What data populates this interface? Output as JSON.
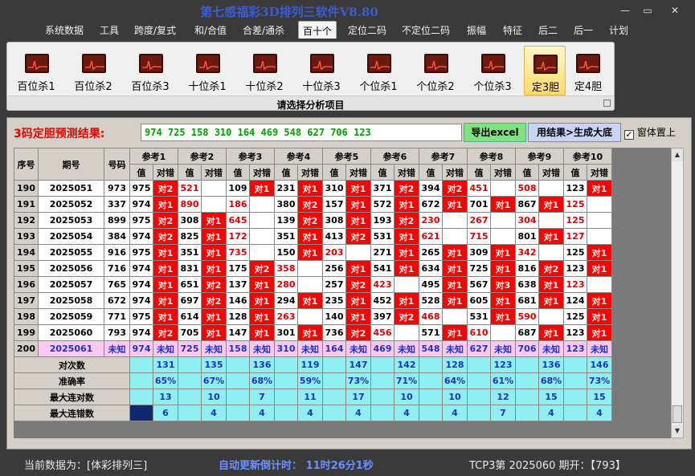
{
  "app": {
    "title": "第七感福彩3D排列三软件V8.80",
    "window_buttons": [
      "—",
      "▭",
      "✕"
    ]
  },
  "menu": {
    "items": [
      "系统数据",
      "工具",
      "跨度/复式",
      "和/合值",
      "合差/通杀",
      "百十个",
      "定位二码",
      "不定位二码",
      "振幅",
      "特征",
      "后二",
      "后一",
      "计划"
    ],
    "active_index": 5
  },
  "ribbon": {
    "buttons": [
      "百位杀1",
      "百位杀2",
      "百位杀3",
      "十位杀1",
      "十位杀2",
      "十位杀3",
      "个位杀1",
      "个位杀2",
      "个位杀3",
      "定3胆",
      "定4胆"
    ],
    "active_index": 9,
    "caption": "请选择分析项目"
  },
  "result": {
    "label": "3码定胆预测结果:",
    "value": "974  725  158  310  164  469  548  627  706  123",
    "excel_button": "导出excel",
    "generate_button": "用结果>生成大底",
    "checkbox_label": "窗体置上",
    "checkbox_checked": true,
    "checkbox_mark": "✓"
  },
  "table": {
    "head_seq": "序号",
    "head_period": "期号",
    "head_number": "号码",
    "refs": [
      "参考1",
      "参考2",
      "参考3",
      "参考4",
      "参考5",
      "参考6",
      "参考7",
      "参考8",
      "参考9",
      "参考10"
    ],
    "sub_value": "值",
    "sub_result": "对错",
    "rows": [
      {
        "seq": "190",
        "period": "2025051",
        "number": "973",
        "cells": [
          [
            "975",
            "对2"
          ],
          [
            "521",
            ""
          ],
          [
            "109",
            "对1"
          ],
          [
            "231",
            "对1"
          ],
          [
            "310",
            "对1"
          ],
          [
            "371",
            "对2"
          ],
          [
            "394",
            "对2"
          ],
          [
            "451",
            ""
          ],
          [
            "508",
            ""
          ],
          [
            "123",
            "对1"
          ]
        ]
      },
      {
        "seq": "191",
        "period": "2025052",
        "number": "337",
        "cells": [
          [
            "974",
            "对1"
          ],
          [
            "890",
            ""
          ],
          [
            "186",
            ""
          ],
          [
            "380",
            "对2"
          ],
          [
            "157",
            "对1"
          ],
          [
            "572",
            "对1"
          ],
          [
            "672",
            "对1"
          ],
          [
            "701",
            "对1"
          ],
          [
            "867",
            "对1"
          ],
          [
            "125",
            ""
          ]
        ]
      },
      {
        "seq": "192",
        "period": "2025053",
        "number": "899",
        "cells": [
          [
            "975",
            "对2"
          ],
          [
            "308",
            "对1"
          ],
          [
            "645",
            ""
          ],
          [
            "139",
            "对2"
          ],
          [
            "308",
            "对1"
          ],
          [
            "193",
            "对2"
          ],
          [
            "230",
            ""
          ],
          [
            "267",
            ""
          ],
          [
            "304",
            ""
          ],
          [
            "125",
            ""
          ]
        ]
      },
      {
        "seq": "193",
        "period": "2025054",
        "number": "384",
        "cells": [
          [
            "974",
            "对2"
          ],
          [
            "825",
            "对1"
          ],
          [
            "172",
            ""
          ],
          [
            "351",
            "对1"
          ],
          [
            "413",
            "对2"
          ],
          [
            "531",
            "对1"
          ],
          [
            "621",
            ""
          ],
          [
            "715",
            ""
          ],
          [
            "801",
            "对1"
          ],
          [
            "127",
            ""
          ]
        ]
      },
      {
        "seq": "194",
        "period": "2025055",
        "number": "916",
        "cells": [
          [
            "975",
            "对1"
          ],
          [
            "351",
            "对1"
          ],
          [
            "735",
            ""
          ],
          [
            "150",
            "对1"
          ],
          [
            "203",
            ""
          ],
          [
            "271",
            "对1"
          ],
          [
            "265",
            "对1"
          ],
          [
            "309",
            "对1"
          ],
          [
            "342",
            ""
          ],
          [
            "125",
            "对1"
          ]
        ]
      },
      {
        "seq": "195",
        "period": "2025056",
        "number": "716",
        "cells": [
          [
            "974",
            "对1"
          ],
          [
            "831",
            "对1"
          ],
          [
            "175",
            "对2"
          ],
          [
            "358",
            ""
          ],
          [
            "256",
            "对1"
          ],
          [
            "541",
            "对1"
          ],
          [
            "634",
            "对1"
          ],
          [
            "725",
            "对1"
          ],
          [
            "816",
            "对2"
          ],
          [
            "123",
            "对1"
          ]
        ]
      },
      {
        "seq": "196",
        "period": "2025057",
        "number": "765",
        "cells": [
          [
            "974",
            "对1"
          ],
          [
            "651",
            "对2"
          ],
          [
            "137",
            "对1"
          ],
          [
            "280",
            ""
          ],
          [
            "257",
            "对2"
          ],
          [
            "423",
            ""
          ],
          [
            "495",
            "对1"
          ],
          [
            "567",
            "对3"
          ],
          [
            "638",
            "对1"
          ],
          [
            "123",
            ""
          ]
        ]
      },
      {
        "seq": "197",
        "period": "2025058",
        "number": "672",
        "cells": [
          [
            "974",
            "对1"
          ],
          [
            "697",
            "对2"
          ],
          [
            "146",
            "对1"
          ],
          [
            "294",
            "对1"
          ],
          [
            "235",
            "对1"
          ],
          [
            "452",
            "对1"
          ],
          [
            "528",
            "对1"
          ],
          [
            "605",
            "对1"
          ],
          [
            "681",
            "对1"
          ],
          [
            "124",
            "对1"
          ]
        ]
      },
      {
        "seq": "198",
        "period": "2025059",
        "number": "771",
        "cells": [
          [
            "975",
            "对1"
          ],
          [
            "614",
            "对1"
          ],
          [
            "128",
            "对1"
          ],
          [
            "263",
            ""
          ],
          [
            "140",
            "对1"
          ],
          [
            "397",
            "对2"
          ],
          [
            "468",
            ""
          ],
          [
            "531",
            "对1"
          ],
          [
            "590",
            ""
          ],
          [
            "125",
            "对1"
          ]
        ]
      },
      {
        "seq": "199",
        "period": "2025060",
        "number": "793",
        "cells": [
          [
            "974",
            "对2"
          ],
          [
            "705",
            "对1"
          ],
          [
            "147",
            "对1"
          ],
          [
            "301",
            "对1"
          ],
          [
            "736",
            "对2"
          ],
          [
            "456",
            ""
          ],
          [
            "571",
            "对1"
          ],
          [
            "610",
            ""
          ],
          [
            "687",
            "对1"
          ],
          [
            "123",
            "对1"
          ]
        ]
      }
    ],
    "predict_row": {
      "seq": "200",
      "period": "2025061",
      "number": "未知",
      "values": [
        "974",
        "725",
        "158",
        "310",
        "164",
        "469",
        "548",
        "627",
        "706",
        "123"
      ],
      "result": "未知"
    },
    "stats": [
      {
        "label": "对次数",
        "values": [
          "131",
          "135",
          "136",
          "119",
          "147",
          "142",
          "128",
          "123",
          "136",
          "146"
        ]
      },
      {
        "label": "准确率",
        "values": [
          "65%",
          "67%",
          "68%",
          "59%",
          "73%",
          "71%",
          "64%",
          "61%",
          "68%",
          "73%"
        ]
      },
      {
        "label": "最大连对数",
        "values": [
          "13",
          "10",
          "7",
          "11",
          "17",
          "10",
          "10",
          "12",
          "15",
          "15"
        ]
      },
      {
        "label": "最大连错数",
        "values": [
          "6",
          "4",
          "4",
          "4",
          "4",
          "4",
          "4",
          "7",
          "4",
          "4"
        ]
      }
    ]
  },
  "status": {
    "current_data": "当前数据为：[体彩排列三]",
    "countdown": "自动更新倒计时：  11时26分1秒",
    "period_info": "TCP3第  2025060  期开：【793】"
  },
  "colors": {
    "accent_red": "#ff0000",
    "predict_pink": "#ffc8f0",
    "stat_cyan": "#8ef0f0",
    "title_blue": "#3b5bd6"
  }
}
